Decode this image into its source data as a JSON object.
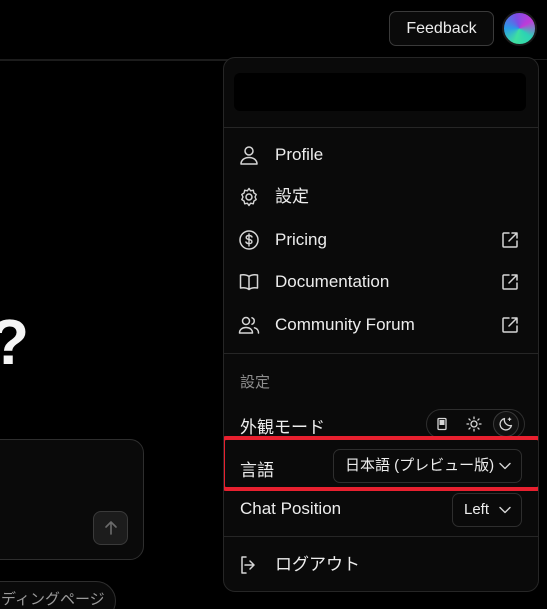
{
  "header": {
    "feedback_label": "Feedback"
  },
  "background": {
    "heading_fragment": "?",
    "pill_text": "ディングページ"
  },
  "menu": {
    "items": [
      {
        "label": "Profile",
        "icon": "user-icon",
        "external": false
      },
      {
        "label": "設定",
        "icon": "gear-icon",
        "external": false
      },
      {
        "label": "Pricing",
        "icon": "dollar-circle-icon",
        "external": true
      },
      {
        "label": "Documentation",
        "icon": "book-icon",
        "external": true
      },
      {
        "label": "Community Forum",
        "icon": "users-icon",
        "external": true
      }
    ],
    "settings_section_label": "設定",
    "appearance_label": "外観モード",
    "appearance_selected": "dark",
    "language_label": "言語",
    "language_value": "日本語 (プレビュー版)",
    "chat_position_label": "Chat Position",
    "chat_position_value": "Left",
    "logout_label": "ログアウト"
  },
  "colors": {
    "highlight": "#e8202f",
    "background": "#000000",
    "menu_background": "#0a0a0a"
  }
}
